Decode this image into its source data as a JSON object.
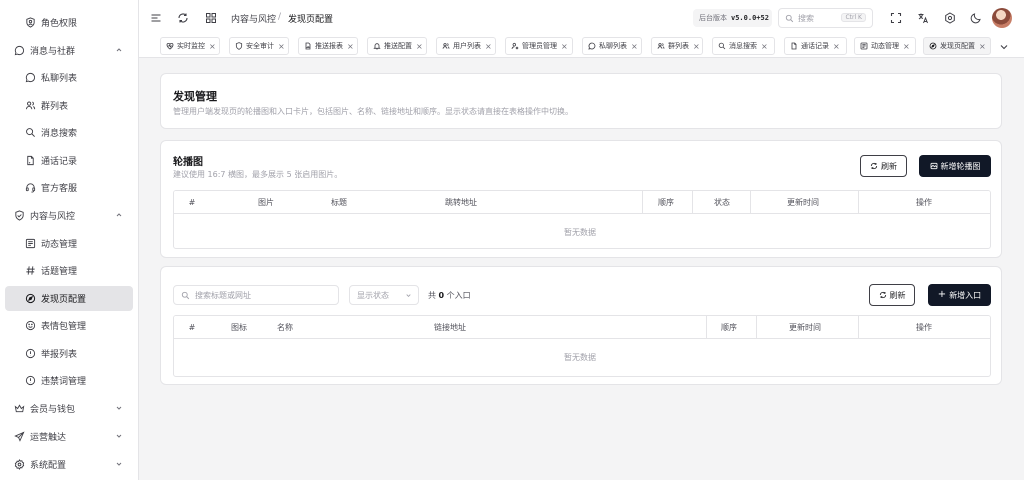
{
  "sidebar": {
    "items": [
      {
        "label": "角色权限",
        "icon": "user-shield-icon",
        "level": 2
      },
      {
        "label": "消息与社群",
        "icon": "message-circle-icon",
        "level": 1,
        "expanded": true
      },
      {
        "label": "私聊列表",
        "icon": "chat-bubble-icon",
        "level": 2
      },
      {
        "label": "群列表",
        "icon": "users-icon",
        "level": 2
      },
      {
        "label": "消息搜索",
        "icon": "search-icon",
        "level": 2
      },
      {
        "label": "通话记录",
        "icon": "file-text-icon",
        "level": 2
      },
      {
        "label": "官方客服",
        "icon": "headset-icon",
        "level": 2
      },
      {
        "label": "内容与风控",
        "icon": "shield-check-icon",
        "level": 1,
        "expanded": true
      },
      {
        "label": "动态管理",
        "icon": "newspaper-icon",
        "level": 2
      },
      {
        "label": "话题管理",
        "icon": "hash-icon",
        "level": 2
      },
      {
        "label": "发现页配置",
        "icon": "compass-icon",
        "level": 2,
        "active": true
      },
      {
        "label": "表情包管理",
        "icon": "smile-icon",
        "level": 2
      },
      {
        "label": "举报列表",
        "icon": "alert-circle-icon",
        "level": 2
      },
      {
        "label": "违禁词管理",
        "icon": "ban-icon",
        "level": 2
      },
      {
        "label": "会员与钱包",
        "icon": "crown-icon",
        "level": 1,
        "expanded": false
      },
      {
        "label": "运营触达",
        "icon": "send-icon",
        "level": 1,
        "expanded": false
      },
      {
        "label": "系统配置",
        "icon": "gear-icon",
        "level": 1,
        "expanded": false
      }
    ]
  },
  "header": {
    "breadcrumb": [
      "内容与风控",
      "发现页配置"
    ],
    "breadcrumb_sep": "/",
    "version_label": "后台版本",
    "version_value": "v5.0.0+52",
    "search_placeholder": "搜索",
    "search_shortcut": "Ctrl K"
  },
  "tabs": [
    {
      "label": "实时监控",
      "icon": "heart-pulse-icon"
    },
    {
      "label": "安全审计",
      "icon": "shield-icon"
    },
    {
      "label": "推送报表",
      "icon": "file-chart-icon"
    },
    {
      "label": "推送配置",
      "icon": "bell-icon"
    },
    {
      "label": "用户列表",
      "icon": "users-icon"
    },
    {
      "label": "管理员管理",
      "icon": "user-cog-icon"
    },
    {
      "label": "私聊列表",
      "icon": "chat-bubble-icon"
    },
    {
      "label": "群列表",
      "icon": "users-icon"
    },
    {
      "label": "消息搜索",
      "icon": "search-icon"
    },
    {
      "label": "通话记录",
      "icon": "file-text-icon"
    },
    {
      "label": "动态管理",
      "icon": "newspaper-icon"
    },
    {
      "label": "发现页配置",
      "icon": "compass-icon",
      "active": true
    }
  ],
  "page": {
    "title": "发现管理",
    "description": "管理用户端发现页的轮播图和入口卡片，包括图片、名称、链接地址和顺序。显示状态请直接在表格操作中切换。"
  },
  "carousel": {
    "title": "轮播图",
    "subtitle": "建议使用 16:7 横图，最多展示 5 张启用图片。",
    "refresh_label": "刷新",
    "add_label": "新增轮播图",
    "columns": [
      "#",
      "图片",
      "标题",
      "跳转地址",
      "顺序",
      "状态",
      "更新时间",
      "操作"
    ],
    "empty_text": "暂无数据"
  },
  "entries": {
    "search_placeholder": "搜索标题或网址",
    "status_placeholder": "显示状态",
    "count_prefix": "共",
    "count_value": "0",
    "count_suffix": "个入口",
    "refresh_label": "刷新",
    "add_label": "新增入口",
    "columns": [
      "#",
      "图标",
      "名称",
      "链接地址",
      "顺序",
      "更新时间",
      "操作"
    ],
    "empty_text": "暂无数据"
  }
}
